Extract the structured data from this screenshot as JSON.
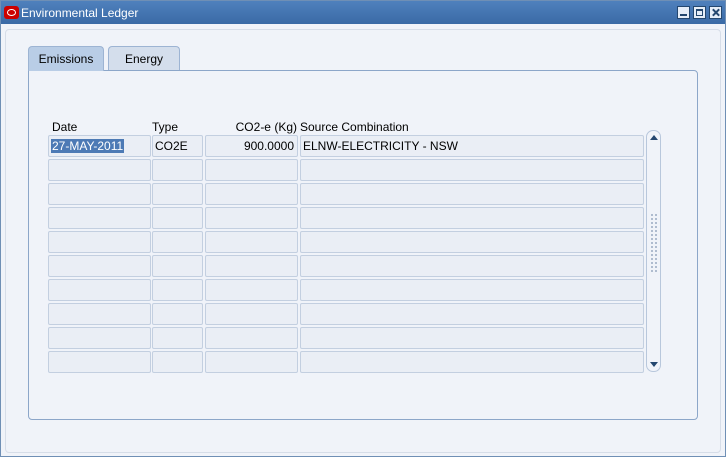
{
  "window": {
    "title": "Environmental Ledger"
  },
  "tabs": [
    {
      "label": "Emissions",
      "active": true
    },
    {
      "label": "Energy",
      "active": false
    }
  ],
  "table": {
    "headers": {
      "date": "Date",
      "type": "Type",
      "co2": "CO2-e (Kg)",
      "source": "Source Combination"
    },
    "rows": [
      {
        "date": "27-MAY-2011",
        "type": "CO2E",
        "co2": "900.0000",
        "source": "ELNW-ELECTRICITY - NSW"
      },
      {
        "date": "",
        "type": "",
        "co2": "",
        "source": ""
      },
      {
        "date": "",
        "type": "",
        "co2": "",
        "source": ""
      },
      {
        "date": "",
        "type": "",
        "co2": "",
        "source": ""
      },
      {
        "date": "",
        "type": "",
        "co2": "",
        "source": ""
      },
      {
        "date": "",
        "type": "",
        "co2": "",
        "source": ""
      },
      {
        "date": "",
        "type": "",
        "co2": "",
        "source": ""
      },
      {
        "date": "",
        "type": "",
        "co2": "",
        "source": ""
      },
      {
        "date": "",
        "type": "",
        "co2": "",
        "source": ""
      },
      {
        "date": "",
        "type": "",
        "co2": "",
        "source": ""
      }
    ]
  },
  "icons": {
    "app": "oracle-logo-icon",
    "minimize": "minimize-icon",
    "maximize": "maximize-icon",
    "close": "close-icon",
    "scroll_up": "scroll-up-icon",
    "scroll_down": "scroll-down-icon"
  },
  "colors": {
    "titlebar": "#3f72b0",
    "active_tab": "#b9cde6",
    "selection": "#4d7ab5",
    "logo": "#cc0000"
  }
}
